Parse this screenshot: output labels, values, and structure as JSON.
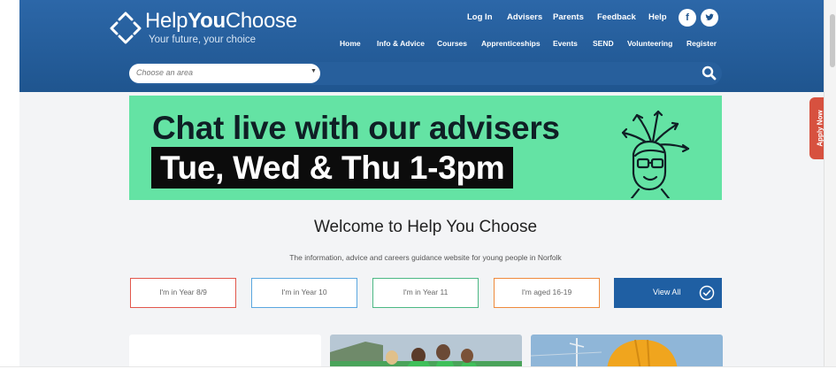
{
  "brand": {
    "title_pre": "Help",
    "title_bold": "You",
    "title_post": "Choose",
    "tagline": "Your future, your choice"
  },
  "topnav": [
    {
      "label": "Log In"
    },
    {
      "label": "Advisers"
    },
    {
      "label": "Parents"
    },
    {
      "label": "Feedback"
    },
    {
      "label": "Help"
    }
  ],
  "social": [
    {
      "icon": "facebook-icon",
      "glyph": "f"
    },
    {
      "icon": "twitter-icon",
      "glyph": "t"
    }
  ],
  "mainnav": [
    {
      "label": "Home"
    },
    {
      "label": "Info & Advice"
    },
    {
      "label": "Courses"
    },
    {
      "label": "Apprenticeships"
    },
    {
      "label": "Events"
    },
    {
      "label": "SEND"
    },
    {
      "label": "Volunteering"
    },
    {
      "label": "Register"
    }
  ],
  "search": {
    "area_placeholder": "Choose an area"
  },
  "banner": {
    "line1": "Chat live with our advisers",
    "line2": "Tue, Wed & Thu 1-3pm"
  },
  "apply_tab": "Apply Now",
  "welcome": {
    "heading": "Welcome to Help You Choose",
    "intro": "The information, advice and careers guidance website for young people in Norfolk"
  },
  "year_buttons": [
    {
      "label": "I'm in Year 8/9",
      "color": "#e2574c"
    },
    {
      "label": "I'm in Year 10",
      "color": "#5aa7e0"
    },
    {
      "label": "I'm in Year 11",
      "color": "#4cb884"
    },
    {
      "label": "I'm aged 16-19",
      "color": "#ef8a3c"
    }
  ],
  "view_all": {
    "label": "View All"
  },
  "colors": {
    "header": "#1f558f",
    "banner": "#64e3a4",
    "apply": "#d7513f",
    "view_all": "#1f5fa3"
  }
}
